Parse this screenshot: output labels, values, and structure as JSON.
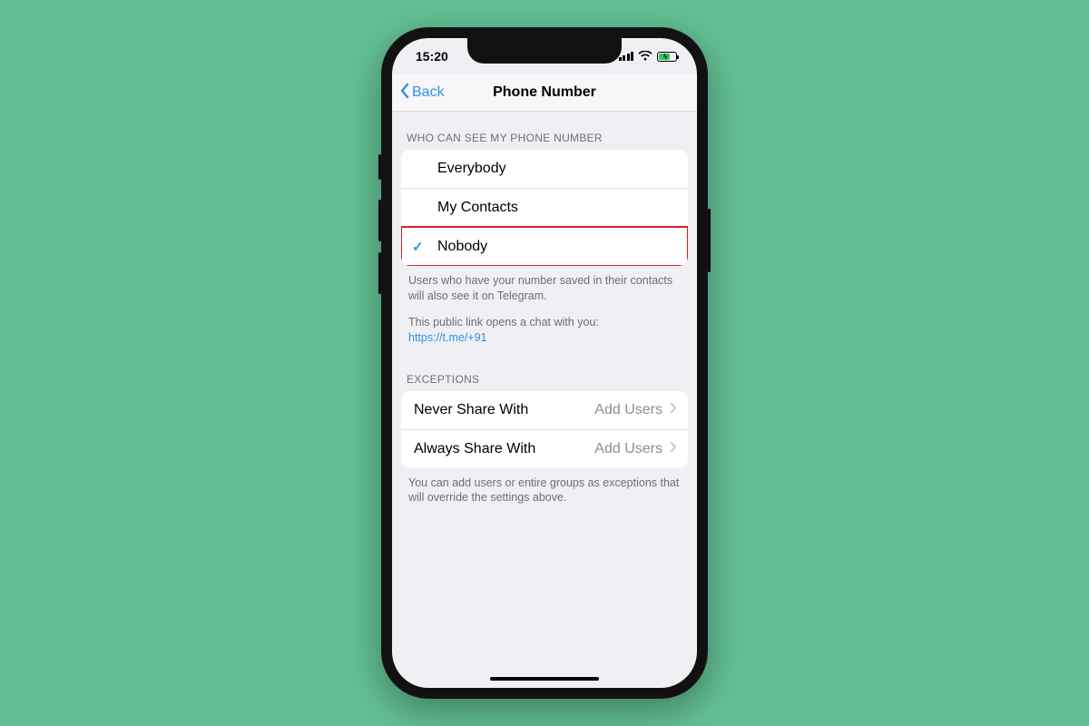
{
  "statusBar": {
    "time": "15:20"
  },
  "nav": {
    "back_label": "Back",
    "title": "Phone Number"
  },
  "sections": {
    "visibility": {
      "header": "WHO CAN SEE MY PHONE NUMBER",
      "options": [
        {
          "label": "Everybody",
          "selected": false,
          "highlight": false
        },
        {
          "label": "My Contacts",
          "selected": false,
          "highlight": false
        },
        {
          "label": "Nobody",
          "selected": true,
          "highlight": true
        }
      ],
      "footer_line1": "Users who have your number saved in their contacts will also see it on Telegram.",
      "footer_line2": "This public link opens a chat with you:",
      "footer_link_text": "https://t.me/+91"
    },
    "exceptions": {
      "header": "EXCEPTIONS",
      "rows": [
        {
          "label": "Never Share With",
          "value": "Add Users"
        },
        {
          "label": "Always Share With",
          "value": "Add Users"
        }
      ],
      "footer": "You can add users or entire groups as exceptions that will override the settings above."
    }
  }
}
